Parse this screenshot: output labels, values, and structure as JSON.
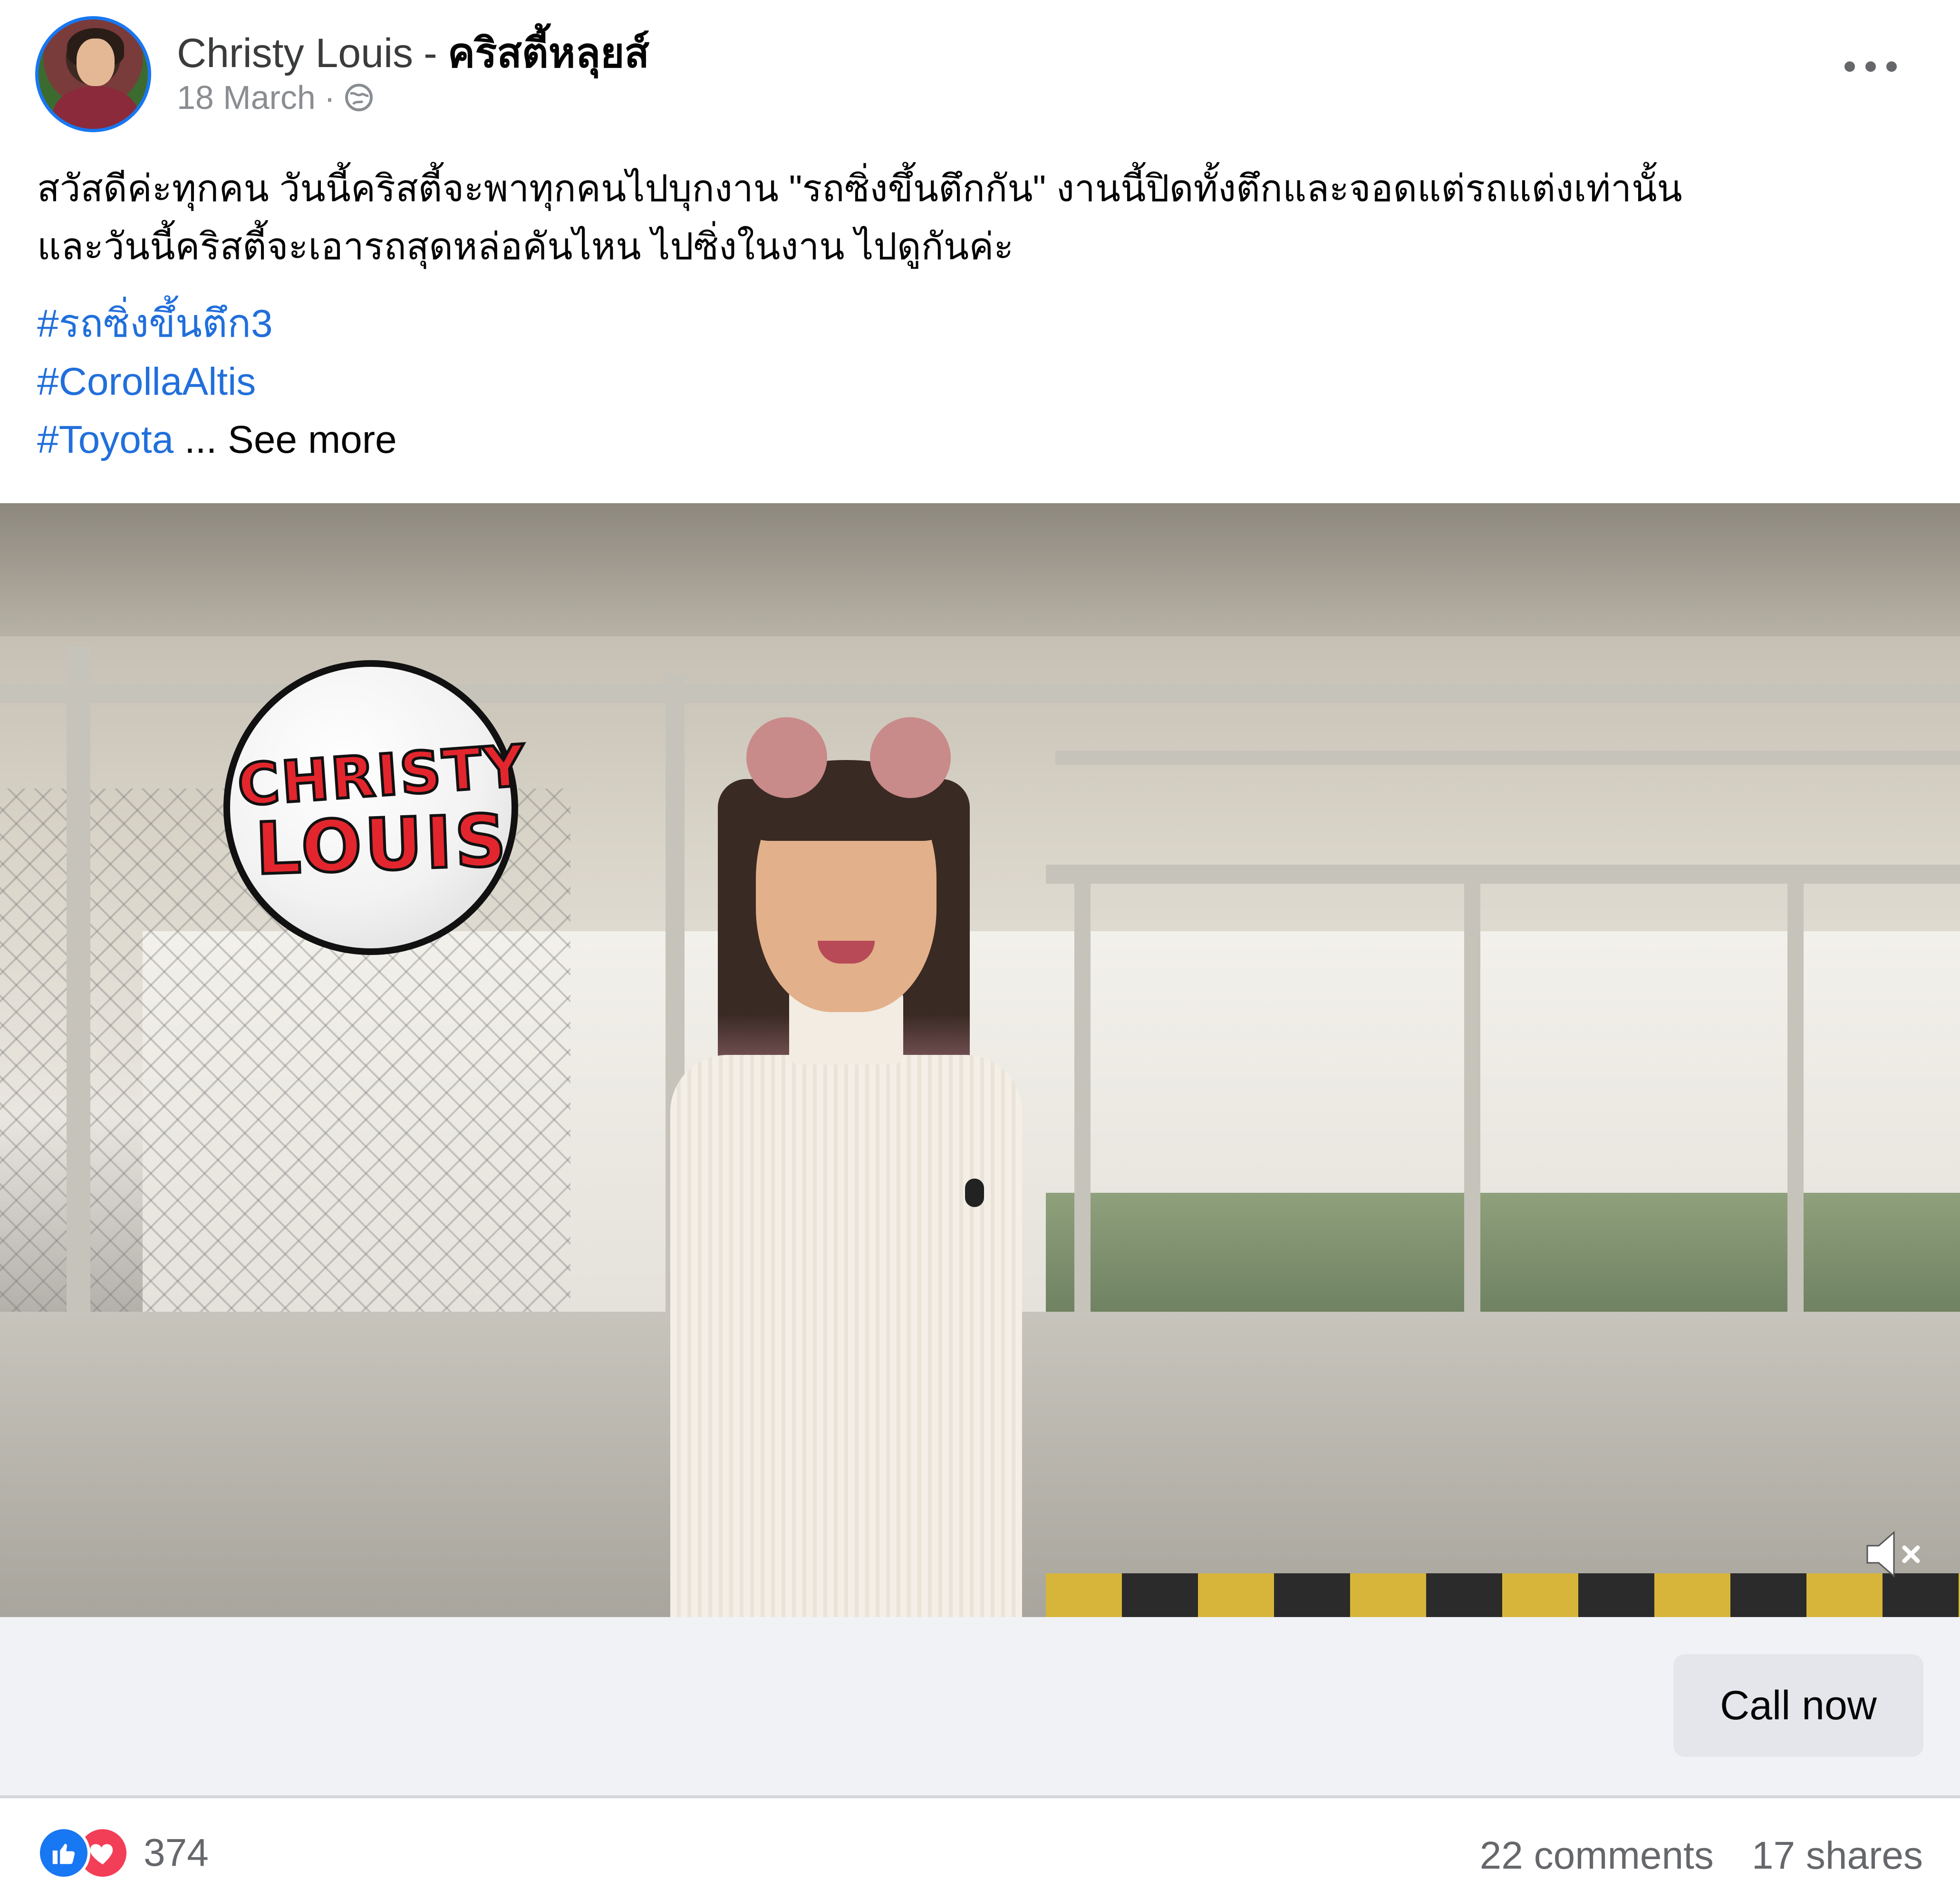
{
  "post": {
    "author": "Christy Louis",
    "author_separator": "-",
    "author_thai": "คริสตี้หลุยส์",
    "date": "18 March",
    "meta_separator": "·",
    "privacy_icon": "globe-icon",
    "more_icon": "more-options-icon",
    "text_lines": [
      "สวัสดีค่ะทุกคน วันนี้คริสตี้จะพาทุกคนไปบุกงาน \"รถซิ่งขึ้นตึกกัน\" งานนี้ปิดทั้งตึกและจอดแต่รถแต่งเท่านั้น",
      "และวันนี้คริสตี้จะเอารถสุดหล่อคันไหน ไปซิ่งในงาน ไปดูกันค่ะ"
    ],
    "hashtags": [
      "#รถซิ่งขึ้นตึก3",
      "#CorollaAltis",
      "#Toyota"
    ],
    "see_more": "... See more"
  },
  "video": {
    "logo_line1": "CHRISTY",
    "logo_line2": "LOUIS",
    "mute_icon": "volume-muted-icon"
  },
  "cta": {
    "label": "Call now"
  },
  "footer": {
    "reactions": [
      "like-icon",
      "love-icon"
    ],
    "reaction_count": "374",
    "comments": "22 comments",
    "shares": "17 shares"
  },
  "colors": {
    "hashtag": "#216fdb",
    "like": "#1877f2",
    "love": "#f33e58",
    "cta_bar": "#f0f2f5",
    "cta_button": "#e4e6eb",
    "secondary_text": "#65676b"
  }
}
